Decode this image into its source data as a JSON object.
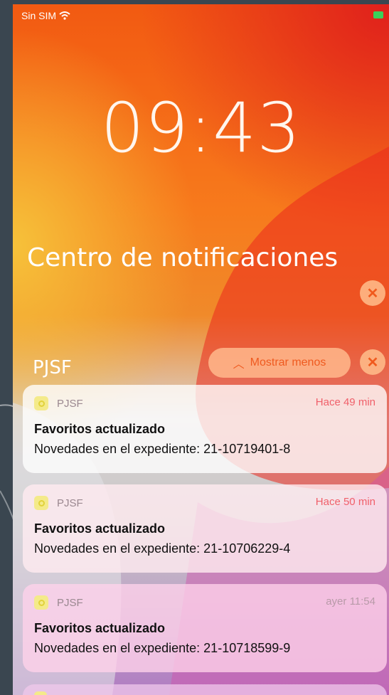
{
  "status_bar": {
    "carrier": "Sin SIM",
    "wifi_icon": "wifi-icon",
    "battery_icon": "battery-icon",
    "battery_color": "#3bd15a"
  },
  "lock": {
    "time": "09:43"
  },
  "notification_center": {
    "title": "Centro de notificaciones",
    "clear_icon": "close-icon"
  },
  "group": {
    "name": "PJSF",
    "collapse_label": "Mostrar menos",
    "collapse_icon": "chevron-up-icon",
    "close_icon": "close-icon"
  },
  "notifications": [
    {
      "app": "PJSF",
      "time": "Hace 49 min",
      "title": "Favoritos actualizado",
      "body": "Novedades en el expediente: 21-10719401-8"
    },
    {
      "app": "PJSF",
      "time": "Hace 50 min",
      "title": "Favoritos actualizado",
      "body": "Novedades en el expediente: 21-10706229-4"
    },
    {
      "app": "PJSF",
      "time": "ayer 11:54",
      "title": "Favoritos actualizado",
      "body": "Novedades en el expediente: 21-10718599-9"
    }
  ],
  "colors": {
    "accent": "#f05a1e",
    "time_recent": "#f0606a"
  }
}
